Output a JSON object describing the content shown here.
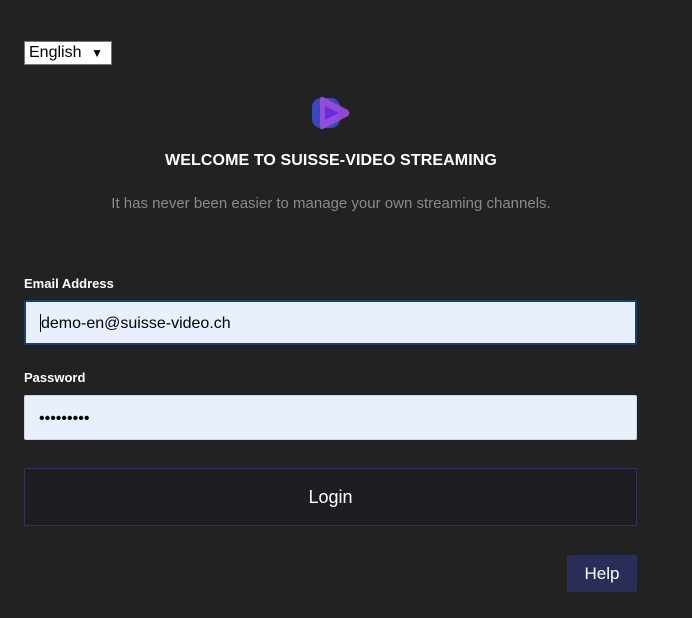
{
  "language": {
    "selected": "English"
  },
  "brand": {
    "logo": "play-logo-icon",
    "logo_colors": {
      "back": "#3d4fd6",
      "front": "#9b4de0",
      "triangle": "#6c2bd9"
    }
  },
  "welcome": {
    "title": "WELCOME TO SUISSE-VIDEO STREAMING",
    "subtitle": "It has never been easier to manage your own streaming channels."
  },
  "form": {
    "email_label": "Email Address",
    "email_value": "demo-en@suisse-video.ch",
    "password_label": "Password",
    "password_value": "•••••••••",
    "login_label": "Login"
  },
  "help": {
    "label": "Help"
  },
  "colors": {
    "background": "#222222",
    "input_background": "#e8f0fe",
    "help_button": "#2a2d57",
    "login_border": "#33335a",
    "subtitle_text": "#8a8a8a"
  }
}
